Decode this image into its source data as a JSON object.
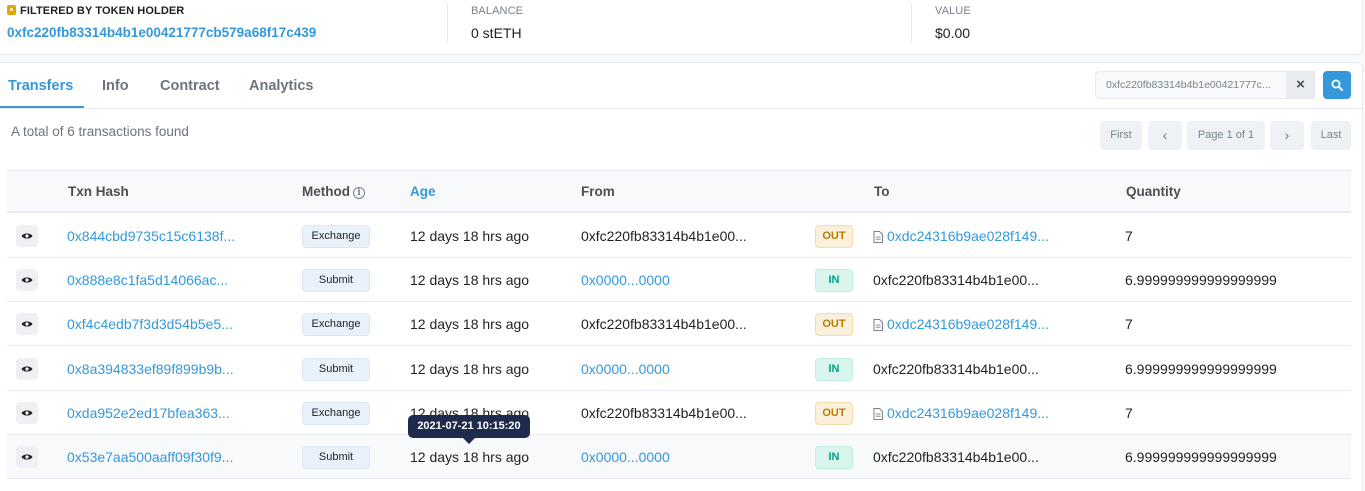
{
  "filter": {
    "holder_label": "FILTERED BY TOKEN HOLDER",
    "holder_address": "0xfc220fb83314b4b1e00421777cb579a68f17c439",
    "balance_label": "BALANCE",
    "balance_value": "0 stETH",
    "value_label": "VALUE",
    "value_value": "$0.00"
  },
  "tabs": [
    {
      "label": "Transfers",
      "active": true
    },
    {
      "label": "Info",
      "active": false
    },
    {
      "label": "Contract",
      "active": false
    },
    {
      "label": "Analytics",
      "active": false
    }
  ],
  "search": {
    "value": "0xfc220fb83314b4b1e00421777c...",
    "clear_label": "×",
    "search_icon": "search-icon"
  },
  "summary": "A total of 6 transactions found",
  "pagination": {
    "first": "First",
    "prev": "‹",
    "page": "Page 1 of 1",
    "next": "›",
    "last": "Last"
  },
  "table": {
    "headers": {
      "txn_hash": "Txn Hash",
      "method": "Method",
      "age": "Age",
      "from": "From",
      "to": "To",
      "quantity": "Quantity"
    },
    "rows": [
      {
        "hash": "0x844cbd9735c15c6138f...",
        "method": "Exchange",
        "age": "12 days 18 hrs ago",
        "from": "0xfc220fb83314b4b1e00...",
        "from_link": false,
        "dir": "OUT",
        "to": "0xdc24316b9ae028f149...",
        "to_contract": true,
        "quantity": "7"
      },
      {
        "hash": "0x888e8c1fa5d14066ac...",
        "method": "Submit",
        "age": "12 days 18 hrs ago",
        "from": "0x0000...0000",
        "from_link": true,
        "dir": "IN",
        "to": "0xfc220fb83314b4b1e00...",
        "to_contract": false,
        "quantity": "6.999999999999999999"
      },
      {
        "hash": "0xf4c4edb7f3d3d54b5e5...",
        "method": "Exchange",
        "age": "12 days 18 hrs ago",
        "from": "0xfc220fb83314b4b1e00...",
        "from_link": false,
        "dir": "OUT",
        "to": "0xdc24316b9ae028f149...",
        "to_contract": true,
        "quantity": "7"
      },
      {
        "hash": "0x8a394833ef89f899b9b...",
        "method": "Submit",
        "age": "12 days 18 hrs ago",
        "from": "0x0000...0000",
        "from_link": true,
        "dir": "IN",
        "to": "0xfc220fb83314b4b1e00...",
        "to_contract": false,
        "quantity": "6.999999999999999999"
      },
      {
        "hash": "0xda952e2ed17bfea363...",
        "method": "Exchange",
        "age": "12 days 18 hrs ago",
        "from": "0xfc220fb83314b4b1e00...",
        "from_link": false,
        "dir": "OUT",
        "to": "0xdc24316b9ae028f149...",
        "to_contract": true,
        "quantity": "7"
      },
      {
        "hash": "0x53e7aa500aaff09f30f9...",
        "method": "Submit",
        "age": "12 days 18 hrs ago",
        "from": "0x0000...0000",
        "from_link": true,
        "dir": "IN",
        "to": "0xfc220fb83314b4b1e00...",
        "to_contract": false,
        "quantity": "6.999999999999999999"
      }
    ]
  },
  "tooltip": "2021-07-21 10:15:20",
  "colors": {
    "accent": "#3498db",
    "out_badge": "#b47d00",
    "in_badge": "#00a186",
    "tooltip_bg": "#1e2b4c"
  }
}
